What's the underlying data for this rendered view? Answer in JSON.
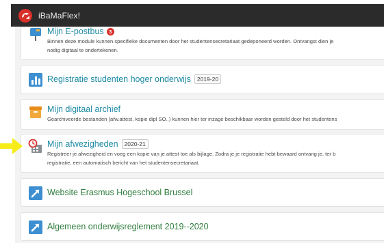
{
  "app": {
    "name": "iBaMaFlex!"
  },
  "cards": [
    {
      "title": "Mijn E-postbus",
      "count": "3",
      "desc1": "Binnen deze module kunnen specifieke documenten door het studentensecretariaat gedeponeerd worden. Ontvangst dien je",
      "desc2": "nodig digitaal te ondertekenen.",
      "icon": "mailbox-icon"
    },
    {
      "title": "Registratie studenten hoger onderwijs",
      "badge": "2019-20",
      "icon": "bar-chart-icon"
    },
    {
      "title": "Mijn digitaal archief",
      "desc1": "Gearchiveerde bestanden (afw.attest, kopie dipl SO..) kunnen hier ter inzage beschikbaar worden gesteld door het studentens",
      "icon": "archive-box-icon"
    },
    {
      "title": "Mijn afwezigheden",
      "badge": "2020-21",
      "desc1": "Registreer je afwezigheid en voeg een kopie van je attest toe als bijlage. Zodra je je registratie hebt bewaard ontvang je, ter b",
      "desc2": "registratie, een automatisch bericht van het studentensecretariaat.",
      "icon": "calendar-clock-icon"
    },
    {
      "title": "Website Erasmus Hogeschool Brussel",
      "icon": "external-link-icon"
    },
    {
      "title": "Algemeen onderwijsreglement 2019--2020",
      "icon": "external-link-icon"
    }
  ],
  "colors": {
    "topbar": "#2b2b2b",
    "title_blue": "#1e8aa5",
    "title_green": "#2f7d3d",
    "badge_red": "#d9302a",
    "marker_yellow": "#f5ec1a"
  }
}
